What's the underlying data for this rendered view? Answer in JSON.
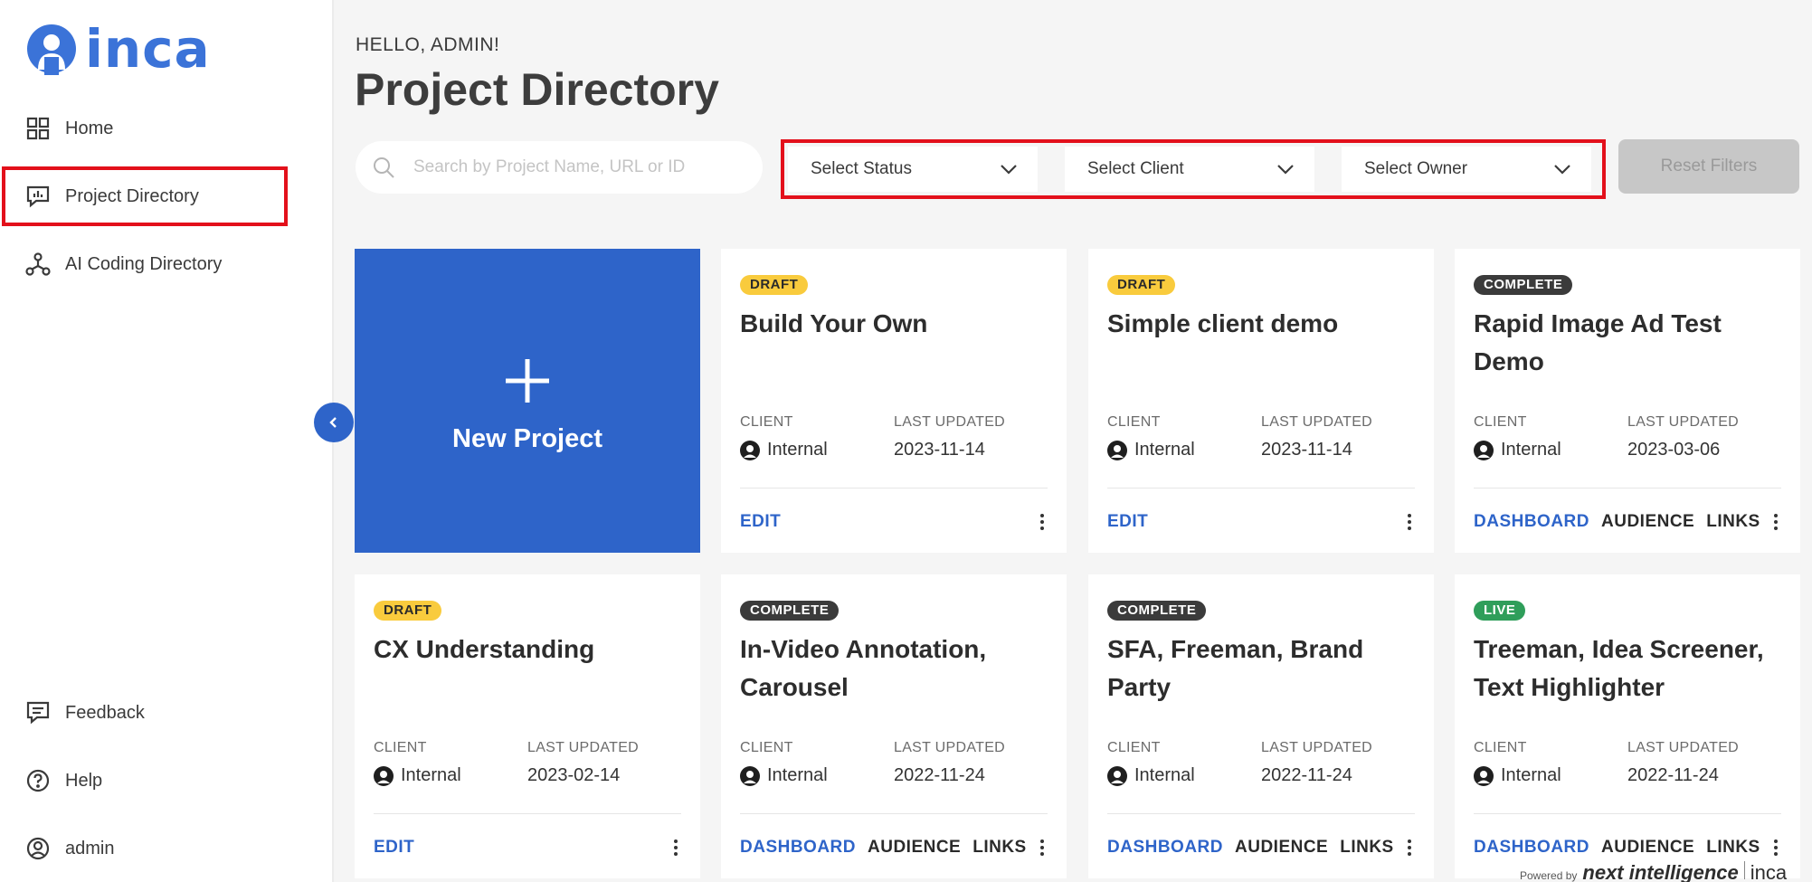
{
  "logo": {
    "text": "inca"
  },
  "greeting": "HELLO, ADMIN!",
  "page_title": "Project Directory",
  "sidebar": {
    "items": [
      {
        "label": "Home",
        "icon": "grid-icon"
      },
      {
        "label": "Project Directory",
        "icon": "chart-board-icon",
        "active": true
      },
      {
        "label": "AI Coding Directory",
        "icon": "network-icon"
      }
    ],
    "bottom_items": [
      {
        "label": "Feedback",
        "icon": "feedback-icon"
      },
      {
        "label": "Help",
        "icon": "help-icon"
      },
      {
        "label": "admin",
        "icon": "user-icon"
      }
    ]
  },
  "search": {
    "placeholder": "Search by Project Name, URL or ID"
  },
  "filters": {
    "status": "Select Status",
    "client": "Select Client",
    "owner": "Select Owner",
    "reset": "Reset Filters"
  },
  "new_project": {
    "label": "New Project"
  },
  "labels": {
    "client": "CLIENT",
    "last_updated": "LAST UPDATED"
  },
  "projects": [
    {
      "status": "DRAFT",
      "title": "Build Your Own",
      "client": "Internal",
      "date": "2023-11-14",
      "actions": [
        "EDIT"
      ]
    },
    {
      "status": "DRAFT",
      "title": "Simple client demo",
      "client": "Internal",
      "date": "2023-11-14",
      "actions": [
        "EDIT"
      ]
    },
    {
      "status": "COMPLETE",
      "title": "Rapid Image Ad Test Demo",
      "client": "Internal",
      "date": "2023-03-06",
      "actions": [
        "DASHBOARD",
        "AUDIENCE",
        "LINKS"
      ]
    },
    {
      "status": "DRAFT",
      "title": "CX Understanding",
      "client": "Internal",
      "date": "2023-02-14",
      "actions": [
        "EDIT"
      ]
    },
    {
      "status": "COMPLETE",
      "title": "In-Video Annotation, Carousel",
      "client": "Internal",
      "date": "2022-11-24",
      "actions": [
        "DASHBOARD",
        "AUDIENCE",
        "LINKS"
      ]
    },
    {
      "status": "COMPLETE",
      "title": "SFA, Freeman, Brand Party",
      "client": "Internal",
      "date": "2022-11-24",
      "actions": [
        "DASHBOARD",
        "AUDIENCE",
        "LINKS"
      ]
    },
    {
      "status": "LIVE",
      "title": "Treeman, Idea Screener, Text Highlighter",
      "client": "Internal",
      "date": "2022-11-24",
      "actions": [
        "DASHBOARD",
        "AUDIENCE",
        "LINKS"
      ]
    }
  ],
  "footer": {
    "powered_by": "Powered by",
    "brand": "next intelligence",
    "product": "inca"
  },
  "colors": {
    "primary": "#2e64c9",
    "highlight": "#e3101b",
    "draft": "#f9cb3d",
    "complete": "#3b3b3b",
    "live": "#2f9e5a"
  }
}
